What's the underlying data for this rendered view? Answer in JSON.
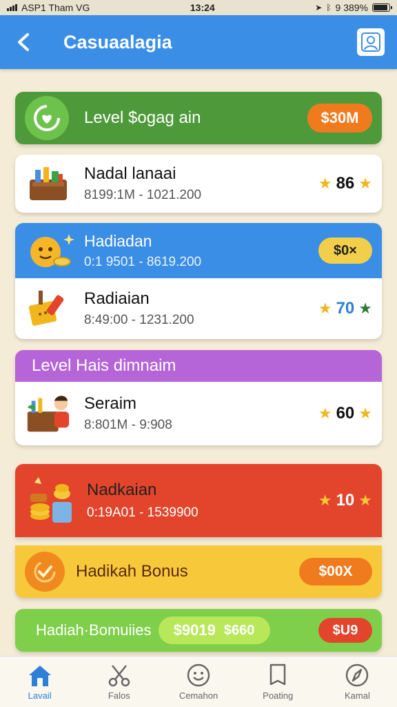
{
  "status": {
    "left": "ASP1 Tham VG",
    "time": "13:24",
    "right": "9 389%",
    "battery_level": 0.89
  },
  "header": {
    "title": "Casuaalagia",
    "back_icon": "chevron-left-icon",
    "profile_icon": "user-icon"
  },
  "cards": {
    "level_banner": {
      "label": "Level $ogag ain",
      "badge": "$30M",
      "color": "#4e9a3a",
      "badge_color": "#f07a1e"
    },
    "item1": {
      "name": "Nadal lanaai",
      "range": "8199:1M - 1021.200",
      "score": "86"
    },
    "blue_header": {
      "name": "Hadiadan",
      "range": "0:1 9501 - 8619.200",
      "badge": "$0×",
      "color": "#3a8ee6",
      "badge_color": "#f2cf4a"
    },
    "item2": {
      "name": "Radiaian",
      "range": "8:49:00 - 1231.200",
      "score": "70"
    },
    "purple_header": {
      "label": "Level Hais dimnaim",
      "color": "#b665d8"
    },
    "item3": {
      "name": "Seraim",
      "range": "8:801M - 9:908",
      "score": "60"
    },
    "red_card": {
      "name": "Nadkaian",
      "range": "0:19A01 - 1539900",
      "score": "10",
      "color": "#e2452b"
    },
    "yellow_card": {
      "label": "Hadikah Bonus",
      "badge": "$00X",
      "color": "#f7c93a",
      "badge_color": "#f07a1e"
    },
    "green_card": {
      "label": "Hadiah·Bomuiies",
      "pill1": "$9019",
      "pill2": "$660",
      "pill3": "$U9",
      "color": "#7fcf4a"
    }
  },
  "nav": [
    {
      "label": "Lavail",
      "icon": "home-icon"
    },
    {
      "label": "Falos",
      "icon": "scissors-icon"
    },
    {
      "label": "Cemahon",
      "icon": "smiley-icon"
    },
    {
      "label": "Poating",
      "icon": "bookmark-icon"
    },
    {
      "label": "Kamal",
      "icon": "compass-icon"
    }
  ]
}
